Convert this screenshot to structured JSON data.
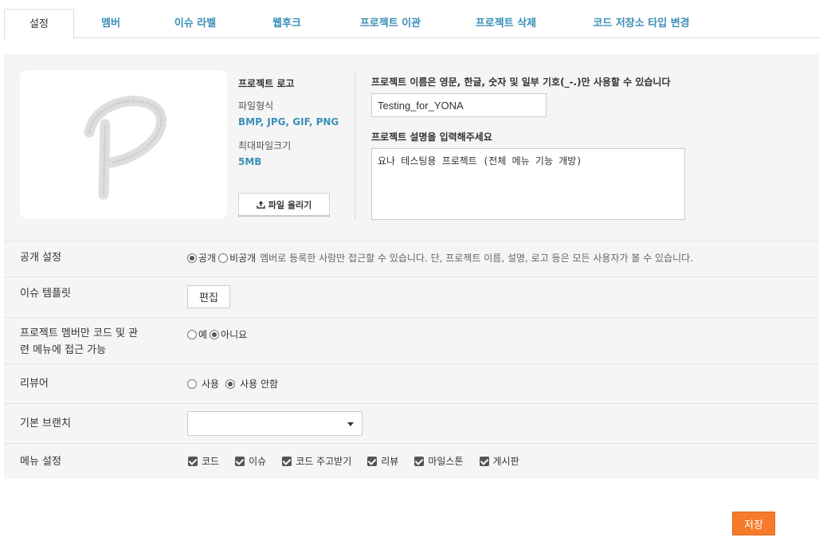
{
  "tabs": [
    {
      "label": "설정",
      "active": true
    },
    {
      "label": "멤버"
    },
    {
      "label": "이슈 라벨"
    },
    {
      "label": "웹후크"
    },
    {
      "label": "프로젝트 이관"
    },
    {
      "label": "프로젝트 삭제"
    },
    {
      "label": "코드 저장소 타입 변경"
    }
  ],
  "logo": {
    "title": "프로젝트 로고",
    "format_label": "파일형식",
    "format_value": "BMP, JPG, GIF, PNG",
    "max_size_label": "최대파일크기",
    "max_size_value": "5MB",
    "upload_label": "파일 올리기",
    "upload_icon": "upload-icon"
  },
  "project": {
    "name_label": "프로젝트 이름은 영문, 한글, 숫자 및 일부 기호(_-.)만 사용할 수 있습니다",
    "name_value": "Testing_for_YONA",
    "desc_label": "프로젝트 설명을 입력해주세요",
    "desc_value": "요나 테스팅용 프로젝트 (전체 메뉴 기능 개방)"
  },
  "visibility": {
    "label": "공개 설정",
    "public_label": "공개",
    "private_label": "비공개",
    "selected": "public",
    "hint": "멤버로 등록한 사람만 접근할 수 있습니다. 단, 프로젝트 이름, 설명, 로고 등은 모든 사용자가 볼 수 있습니다."
  },
  "issue_template": {
    "label": "이슈 템플릿",
    "edit_label": "편집"
  },
  "member_only": {
    "label_line1": "프로젝트 멤버만 코드 및 관",
    "label_line2": "련 메뉴에 접근 가능",
    "yes_label": "예",
    "no_label": "아니요",
    "selected": "no"
  },
  "reviewer": {
    "label": "리뷰어",
    "use_label": "사용",
    "nouse_label": "사용 안함",
    "selected": "nouse"
  },
  "default_branch": {
    "label": "기본 브랜치",
    "value": ""
  },
  "menu": {
    "label": "메뉴 설정",
    "items": [
      "코드",
      "이슈",
      "코드 주고받기",
      "리뷰",
      "마일스톤",
      "게시판"
    ]
  },
  "save_label": "저장",
  "colors": {
    "accent": "#3a8fb7",
    "save": "#f77a2b"
  }
}
